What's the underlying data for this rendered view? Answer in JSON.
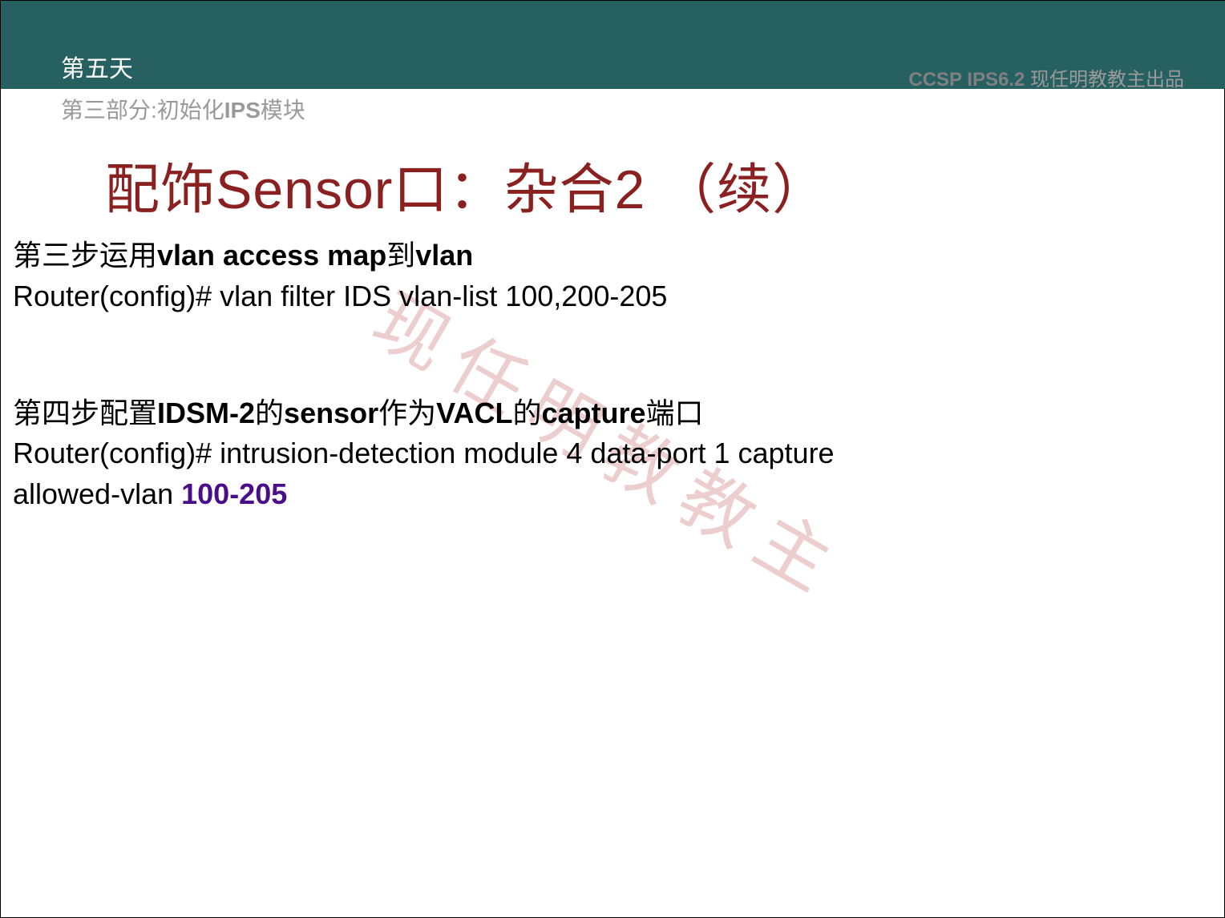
{
  "header": {
    "day": "第五天",
    "course_code": "CCSP IPS6.2",
    "author": "现任明教教主出品",
    "subtitle_prefix": "第三部分:初始化",
    "subtitle_bold": "IPS",
    "subtitle_suffix": "模块"
  },
  "title": "配饰Sensor口：杂合2  （续）",
  "watermark": "现任明教教主",
  "step3": {
    "heading_prefix": "第三步运用",
    "heading_bold1": "vlan access map",
    "heading_mid": "到",
    "heading_bold2": "vlan",
    "code": "Router(config)# vlan filter IDS vlan-list 100,200-205"
  },
  "step4": {
    "heading_prefix": "第四步配置",
    "heading_bold1": "IDSM-2",
    "heading_mid1": "的",
    "heading_bold2": "sensor",
    "heading_mid2": "作为",
    "heading_bold3": "VACL",
    "heading_mid3": "的",
    "heading_bold4": "capture",
    "heading_suffix": "端口",
    "code_line1": "Router(config)# intrusion-detection module 4 data-port 1 capture",
    "code_line2_prefix": "allowed-vlan ",
    "code_line2_highlight": "100-205"
  }
}
